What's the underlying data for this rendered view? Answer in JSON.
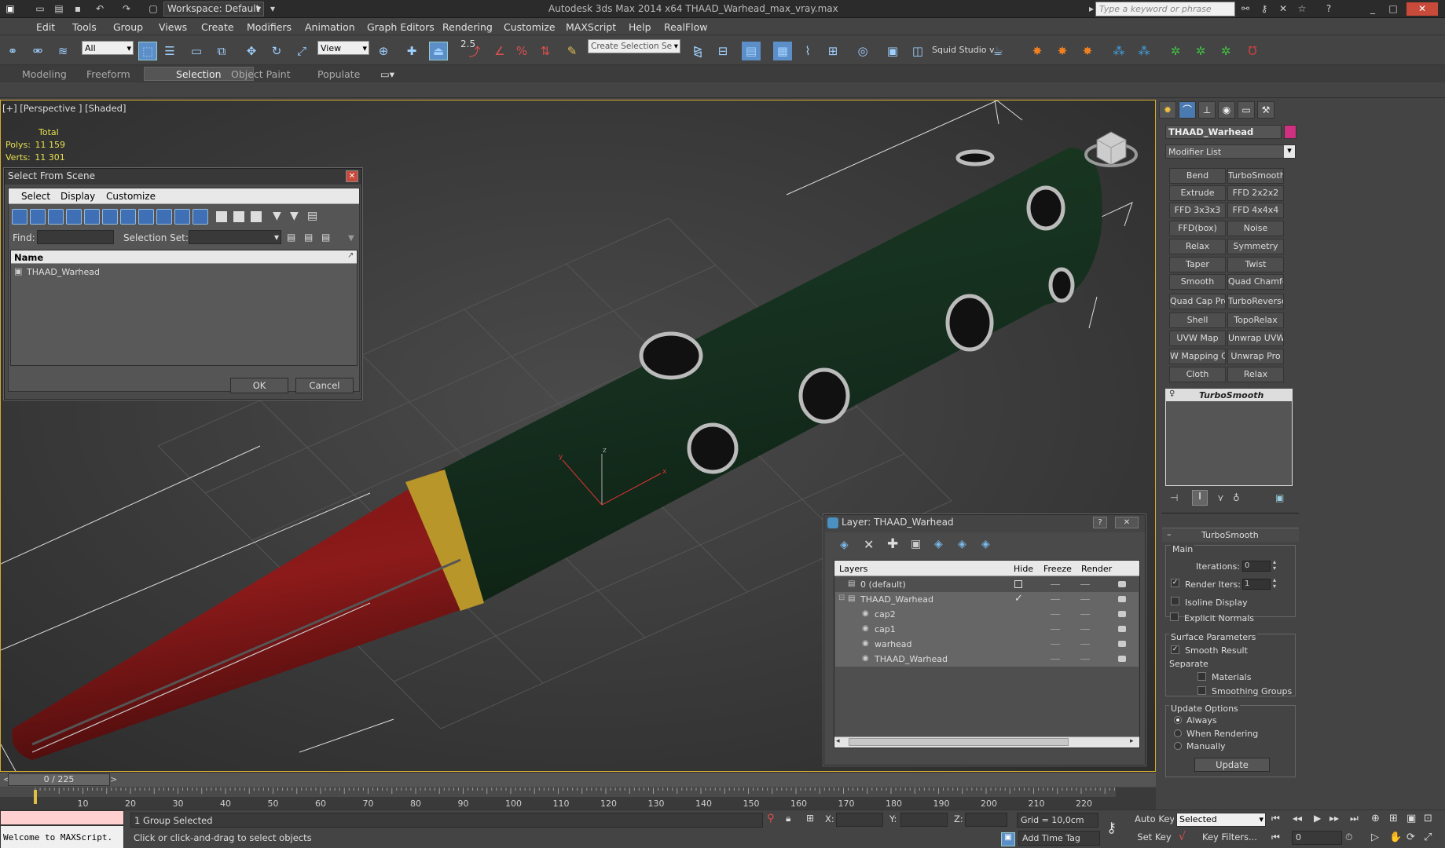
{
  "window": {
    "title": "Autodesk 3ds Max  2014 x64     THAAD_Warhead_max_vray.max",
    "workspace": "Workspace: Default",
    "search_placeholder": "Type a keyword or phrase"
  },
  "menu": [
    "Edit",
    "Tools",
    "Group",
    "Views",
    "Create",
    "Modifiers",
    "Animation",
    "Graph Editors",
    "Rendering",
    "Customize",
    "MAXScript",
    "Help",
    "RealFlow"
  ],
  "toolbar": {
    "filter": "All",
    "refcoord": "View",
    "selset": "Create Selection Se",
    "squid": "Squid Studio v",
    "snap_angle": "2.5"
  },
  "ribbon": {
    "tabs": [
      "Modeling",
      "Freeform",
      "Selection",
      "Object Paint",
      "Populate"
    ],
    "active": "Selection"
  },
  "viewport": {
    "label": "[+] [Perspective ] [Shaded]",
    "stats_total": "Total",
    "polys_label": "Polys:",
    "polys": "11 159",
    "verts_label": "Verts:",
    "verts": "11 301"
  },
  "select_dialog": {
    "title": "Select From Scene",
    "menu": [
      "Select",
      "Display",
      "Customize"
    ],
    "find_label": "Find:",
    "selset_label": "Selection Set:",
    "col_name": "Name",
    "items": [
      "THAAD_Warhead"
    ],
    "ok": "OK",
    "cancel": "Cancel"
  },
  "layer_dialog": {
    "title": "Layer: THAAD_Warhead",
    "help": "?",
    "cols": {
      "layers": "Layers",
      "hide": "Hide",
      "freeze": "Freeze",
      "render": "Render"
    },
    "rows": [
      {
        "name": "0 (default)",
        "level": 0
      },
      {
        "name": "THAAD_Warhead",
        "level": 0
      },
      {
        "name": "cap2",
        "level": 1
      },
      {
        "name": "cap1",
        "level": 1
      },
      {
        "name": "warhead",
        "level": 1
      },
      {
        "name": "THAAD_Warhead",
        "level": 1
      }
    ]
  },
  "command_panel": {
    "object_name": "THAAD_Warhead",
    "modifier_list": "Modifier List",
    "buttons": [
      "Bend",
      "TurboSmooth",
      "Extrude",
      "FFD 2x2x2",
      "FFD 3x3x3",
      "FFD 4x4x4",
      "FFD(box)",
      "Noise",
      "Relax",
      "Symmetry",
      "Taper",
      "Twist",
      "Smooth",
      "Quad Chamfer",
      "Quad Cap Pro",
      "TurboReverse",
      "Shell",
      "TopoRelax",
      "UVW Map",
      "Unwrap UVW",
      "W Mapping Cle",
      "Unwrap Pro",
      "Cloth",
      "Relax"
    ],
    "stack_item": "TurboSmooth",
    "rollout": {
      "title": "TurboSmooth",
      "main": "Main",
      "iterations_label": "Iterations:",
      "iterations": "0",
      "render_iters_label": "Render Iters:",
      "render_iters": "1",
      "isoline": "Isoline Display",
      "explicit": "Explicit Normals",
      "surface": "Surface Parameters",
      "smooth_result": "Smooth Result",
      "separate": "Separate",
      "materials": "Materials",
      "smoothing_groups": "Smoothing Groups",
      "update_options": "Update Options",
      "always": "Always",
      "when_rendering": "When Rendering",
      "manually": "Manually",
      "update": "Update"
    }
  },
  "timeline": {
    "frame": "0 / 225",
    "ticks": [
      "10",
      "20",
      "30",
      "40",
      "50",
      "60",
      "70",
      "80",
      "90",
      "100",
      "110",
      "120",
      "130",
      "140",
      "150",
      "160",
      "170",
      "180",
      "190",
      "200",
      "210",
      "220"
    ]
  },
  "status": {
    "maxscript": "Welcome to MAXScript.",
    "selected": "1 Group Selected",
    "prompt": "Click or click-and-drag to select objects",
    "x": "X:",
    "y": "Y:",
    "z": "Z:",
    "grid": "Grid = 10,0cm",
    "add_time_tag": "Add Time Tag",
    "auto_key": "Auto Key",
    "set_key": "Set Key",
    "key_mode": "Selected",
    "key_filters": "Key Filters...",
    "frame_field": "0"
  }
}
